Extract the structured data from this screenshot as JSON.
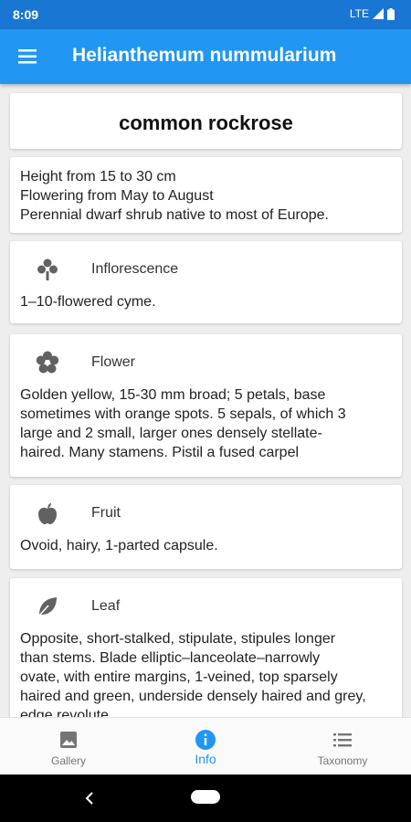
{
  "status_bar": {
    "time": "8:09",
    "network": "LTE"
  },
  "app_bar": {
    "title": "Helianthemum nummularium",
    "menu_icon": "menu-icon"
  },
  "plant": {
    "common_name": "common rockrose",
    "facts": [
      "Height from 15 to 30 cm",
      "Flowering from May to August",
      "Perennial dwarf shrub native to most of Europe."
    ]
  },
  "sections": [
    {
      "title": "Inflorescence",
      "icon": "inflorescence-icon",
      "lines": [
        "1–10-flowered cyme."
      ]
    },
    {
      "title": "Flower",
      "icon": "flower-icon",
      "lines": [
        "Golden yellow, 15-30 mm broad; 5 petals, base",
        "sometimes with orange spots. 5 sepals, of which 3",
        "large and 2 small, larger ones densely stellate-",
        "haired. Many stamens. Pistil a fused carpel"
      ]
    },
    {
      "title": "Fruit",
      "icon": "fruit-icon",
      "lines": [
        "Ovoid, hairy, 1-parted capsule."
      ]
    },
    {
      "title": "Leaf",
      "icon": "leaf-icon",
      "lines": [
        "Opposite, short-stalked, stipulate, stipules longer",
        "than stems. Blade elliptic–lanceolate–narrowly",
        "ovate, with entire margins, 1-veined, top sparsely",
        "haired and green, underside densely haired and grey,",
        "edge revolute"
      ]
    }
  ],
  "bottom_nav": {
    "active": "Info",
    "items": [
      {
        "label": "Gallery",
        "icon": "gallery-icon"
      },
      {
        "label": "Info",
        "icon": "info-icon"
      },
      {
        "label": "Taxonomy",
        "icon": "list-icon"
      }
    ]
  },
  "colors": {
    "primary": "#2196f3",
    "status_bar": "#1976d2",
    "icon_grey": "#616161",
    "background": "#eeeeee"
  }
}
